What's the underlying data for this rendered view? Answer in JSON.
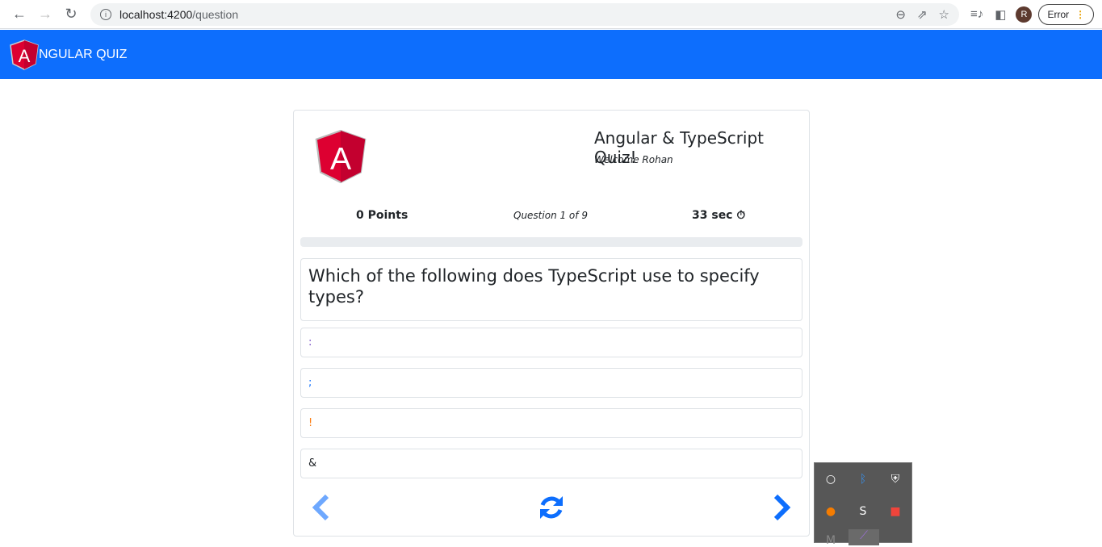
{
  "browser": {
    "url_host": "localhost:4200",
    "url_path": "/question",
    "profile_initial": "R",
    "error_label": "Error"
  },
  "navbar": {
    "logo_letter": "A",
    "brand": "NGULAR QUIZ",
    "color": "#0d6efd"
  },
  "quiz": {
    "title": "Angular & TypeScript Quiz!",
    "welcome": "Welcome Rohan",
    "points": "0 Points",
    "question_counter": "Question 1 of 9",
    "timer": "33 sec",
    "progress_percent": 0,
    "question": "Which of the following does TypeScript use to specify types?",
    "options": [
      {
        "text": ":",
        "color": "#6f42c1"
      },
      {
        "text": ";",
        "color": "#0d6efd"
      },
      {
        "text": "!",
        "color": "#fd7e14"
      },
      {
        "text": "&",
        "color": "#212529"
      }
    ]
  },
  "controls": {
    "prev": "previous-icon",
    "refresh": "refresh-icon",
    "next": "next-icon"
  },
  "tray": {
    "icons": [
      "cortana-icon",
      "bluetooth-icon",
      "security-warning-icon",
      "app-error-icon",
      "app-s-icon",
      "anydesk-icon",
      "m-icon",
      "vs-icon"
    ]
  }
}
